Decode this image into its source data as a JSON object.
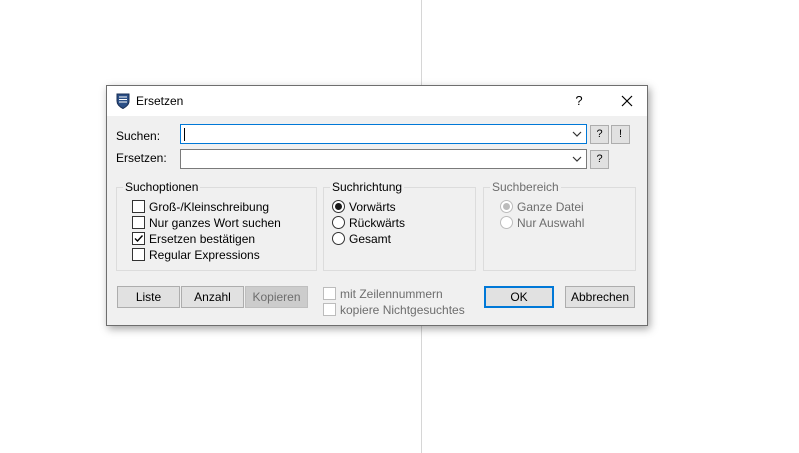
{
  "dialog": {
    "title": "Ersetzen",
    "help_glyph": "?",
    "close_glyph": "✕"
  },
  "search": {
    "label": "Suchen:",
    "value": "",
    "help_label": "?",
    "special_label": "!"
  },
  "replace": {
    "label": "Ersetzen:",
    "value": "",
    "help_label": "?"
  },
  "options": {
    "title": "Suchoptionen",
    "items": [
      {
        "label": "Groß-/Kleinschreibung",
        "checked": false
      },
      {
        "label": "Nur ganzes Wort suchen",
        "checked": false
      },
      {
        "label": "Ersetzen bestätigen",
        "checked": true
      },
      {
        "label": "Regular Expressions",
        "checked": false
      }
    ]
  },
  "direction": {
    "title": "Suchrichtung",
    "items": [
      {
        "label": "Vorwärts",
        "selected": true
      },
      {
        "label": "Rückwärts",
        "selected": false
      },
      {
        "label": "Gesamt",
        "selected": false
      }
    ]
  },
  "range": {
    "title": "Suchbereich",
    "enabled": false,
    "items": [
      {
        "label": "Ganze Datei",
        "selected": true
      },
      {
        "label": "Nur Auswahl",
        "selected": false
      }
    ]
  },
  "buttons": {
    "liste": "Liste",
    "anzahl": "Anzahl",
    "kopieren": "Kopieren",
    "ok": "OK",
    "abbrechen": "Abbrechen"
  },
  "extras": {
    "line_numbers": "mit Zeilennummern",
    "copy_unmatched": "kopiere Nichtgesuchtes"
  },
  "colors": {
    "accent": "#0078d7",
    "dialog_bg": "#f0f0f0"
  },
  "icons": {
    "app": "shield-icon",
    "dropdown": "chevron-down-icon",
    "check": "check-icon"
  }
}
